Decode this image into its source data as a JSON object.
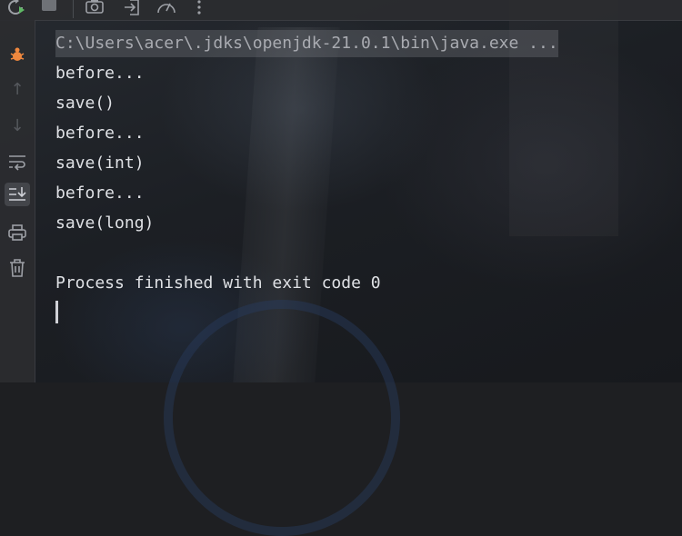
{
  "toolbar": {
    "icons": [
      "rerun-icon",
      "stop-icon",
      "screenshot-icon",
      "exit-icon",
      "profiler-icon",
      "more-icon"
    ]
  },
  "sidebar": {
    "icons": [
      "debug-icon",
      "up-arrow-icon",
      "down-arrow-icon",
      "soft-wrap-icon",
      "scroll-to-end-icon",
      "print-icon",
      "trash-icon"
    ]
  },
  "console": {
    "command": "C:\\Users\\acer\\.jdks\\openjdk-21.0.1\\bin\\java.exe ...",
    "lines": [
      "before...",
      "save()",
      "before...",
      "save(int)",
      "before...",
      "save(long)",
      "",
      "Process finished with exit code 0"
    ]
  },
  "colors": {
    "toolbar_bg": "#2b2d30",
    "text": "#dfe1e5",
    "accent_orange": "#f0883e",
    "accent_green": "#5fb865"
  }
}
